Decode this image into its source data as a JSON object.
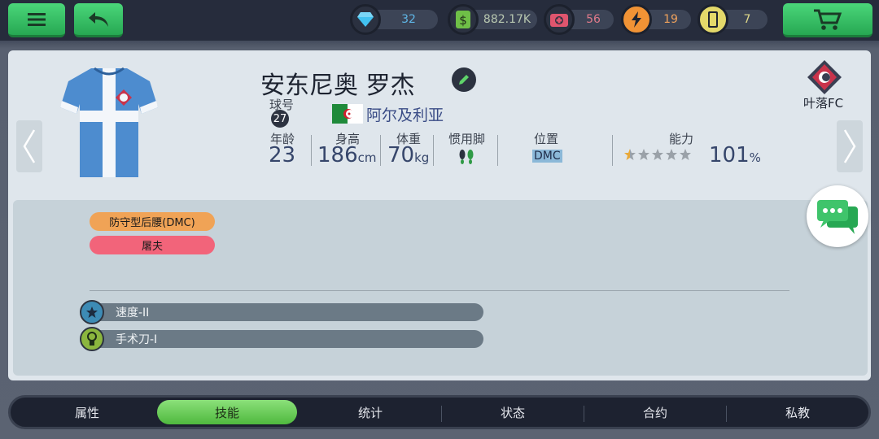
{
  "topbar": {
    "menu_icon": "menu-icon",
    "back_icon": "back-arrow-icon",
    "resources": [
      {
        "name": "diamond",
        "icon": "diamond-icon",
        "value": "32",
        "color": "#42c2f0",
        "text_color": "#5fb6e6"
      },
      {
        "name": "cash",
        "icon": "money-icon",
        "value": "882.17K",
        "color": "#6fbf47",
        "text_color": "#b8c7b0"
      },
      {
        "name": "medkit",
        "icon": "medkit-icon",
        "value": "56",
        "color": "#e0556e",
        "text_color": "#e07a8a"
      },
      {
        "name": "energy",
        "icon": "lightning-icon",
        "value": "19",
        "color": "#f19335",
        "text_color": "#f0a25c"
      },
      {
        "name": "card",
        "icon": "card-icon",
        "value": "7",
        "color": "#e4d96a",
        "text_color": "#e0d98a"
      }
    ],
    "cart_icon": "cart-icon"
  },
  "player": {
    "name": "安东尼奥 罗杰",
    "number_label": "球号",
    "number": "27",
    "country": "阿尔及利亚",
    "flag_colors": {
      "green": "#1f8a3a",
      "white": "#ffffff",
      "red": "#d21f2c"
    },
    "stats": {
      "age_label": "年龄",
      "age": "23",
      "height_label": "身高",
      "height": "186",
      "height_unit": "cm",
      "weight_label": "体重",
      "weight": "70",
      "weight_unit": "kg",
      "foot_label": "惯用脚",
      "position_label": "位置",
      "position": "DMC",
      "ability_label": "能力",
      "ability_value": "101",
      "ability_unit": "%",
      "stars_filled": 0.5,
      "stars_total": 5
    }
  },
  "club": {
    "name": "叶落FC",
    "logo_icon": "club-crest-icon"
  },
  "roles": [
    {
      "label": "防守型后腰(DMC)",
      "color": "#f0a356"
    },
    {
      "label": "屠夫",
      "color": "#f2647a"
    }
  ],
  "skills": [
    {
      "label": "速度-II",
      "icon": "star-badge-icon",
      "icon_color": "#3d8bb5"
    },
    {
      "label": "手术刀-I",
      "icon": "medal-badge-icon",
      "icon_color": "#8bb63e"
    }
  ],
  "tabs": [
    {
      "label": "属性",
      "active": false
    },
    {
      "label": "技能",
      "active": true
    },
    {
      "label": "统计",
      "active": false
    },
    {
      "label": "状态",
      "active": false
    },
    {
      "label": "合约",
      "active": false
    },
    {
      "label": "私教",
      "active": false
    }
  ]
}
